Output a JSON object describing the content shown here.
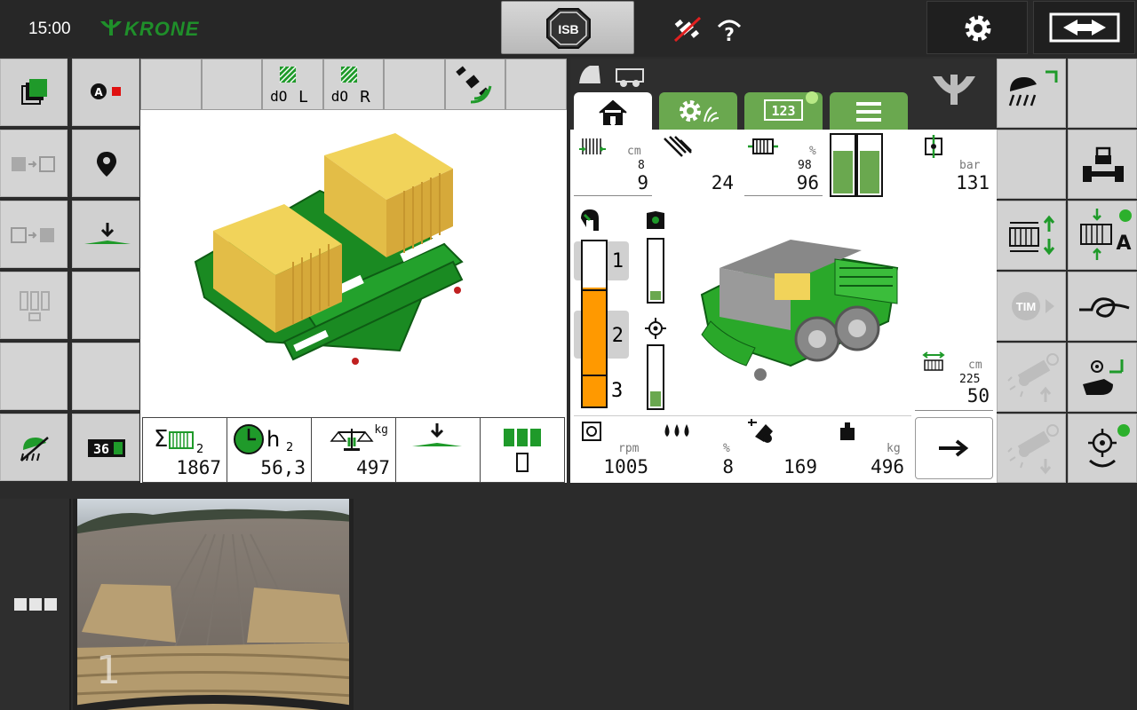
{
  "status_bar": {
    "time": "15:00",
    "brand": "KRONE",
    "isb_label": "ISB"
  },
  "left_panel": {
    "toolbar": {
      "left_pedal_label": "L",
      "right_pedal_label": "R"
    },
    "stats": {
      "bales_total_subscript": "2",
      "bales_total": "1867",
      "hours_label": "h",
      "hours_subscript": "2",
      "hours_value": "56,3",
      "weight_unit": "kg",
      "weight_value": "497"
    }
  },
  "right_panel": {
    "tabs": [
      "home",
      "settings",
      "counters",
      "menu"
    ],
    "top_row": [
      {
        "unit": "cm",
        "small": "8",
        "value": "9"
      },
      {
        "unit": "",
        "small": "",
        "value": "24"
      },
      {
        "unit": "%",
        "small": "98",
        "value": "96"
      },
      {
        "unit": "bar",
        "small": "",
        "value": "131"
      }
    ],
    "pressure_bars": [
      0.75,
      0.75
    ],
    "chamber_levels": [
      "1",
      "2",
      "3"
    ],
    "chamber_fill": 0.72,
    "moisture_level": 0.15,
    "knotter_level": 0.25,
    "bale_length": {
      "unit": "cm",
      "small": "225",
      "value": "50"
    },
    "bottom_row": [
      {
        "unit": "rpm",
        "value": "1005"
      },
      {
        "unit": "%",
        "value": "8"
      },
      {
        "unit": "",
        "value": "169"
      },
      {
        "unit": "kg",
        "value": "496"
      }
    ]
  },
  "side_buttons": {
    "tim_label": "TIM",
    "auto_label": "A"
  },
  "camera": {
    "channel": "1"
  },
  "colors": {
    "krone_green": "#1f8f2a",
    "accent_green": "#6aa84f",
    "bale_orange": "#ff9900",
    "button_gray": "#d0d0d0"
  }
}
